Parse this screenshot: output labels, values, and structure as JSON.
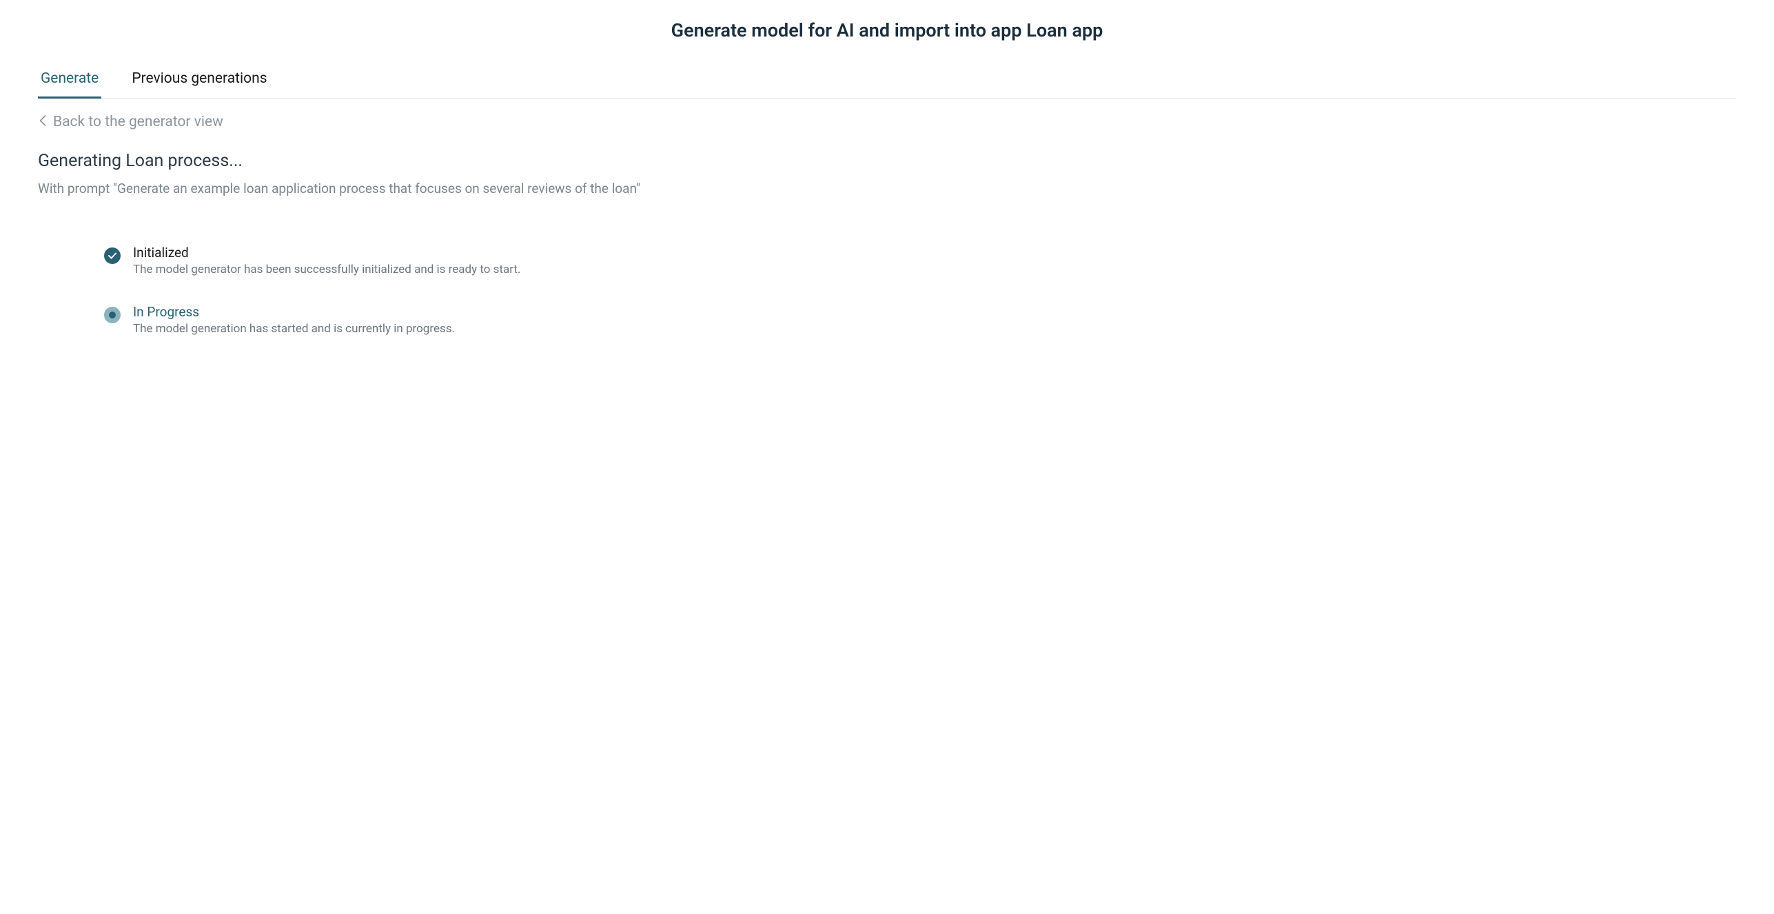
{
  "header": {
    "title": "Generate model for AI and import into app Loan app"
  },
  "tabs": [
    {
      "label": "Generate",
      "active": true
    },
    {
      "label": "Previous generations",
      "active": false
    }
  ],
  "backLink": {
    "label": "Back to the generator view"
  },
  "generating": {
    "title": "Generating Loan process...",
    "promptText": "With prompt \"Generate an example loan application process that focuses on several reviews of the loan\""
  },
  "statusItems": [
    {
      "state": "completed",
      "title": "Initialized",
      "description": "The model generator has been successfully initialized and is ready to start."
    },
    {
      "state": "in-progress",
      "title": "In Progress",
      "description": "The model generation has started and is currently in progress."
    }
  ]
}
